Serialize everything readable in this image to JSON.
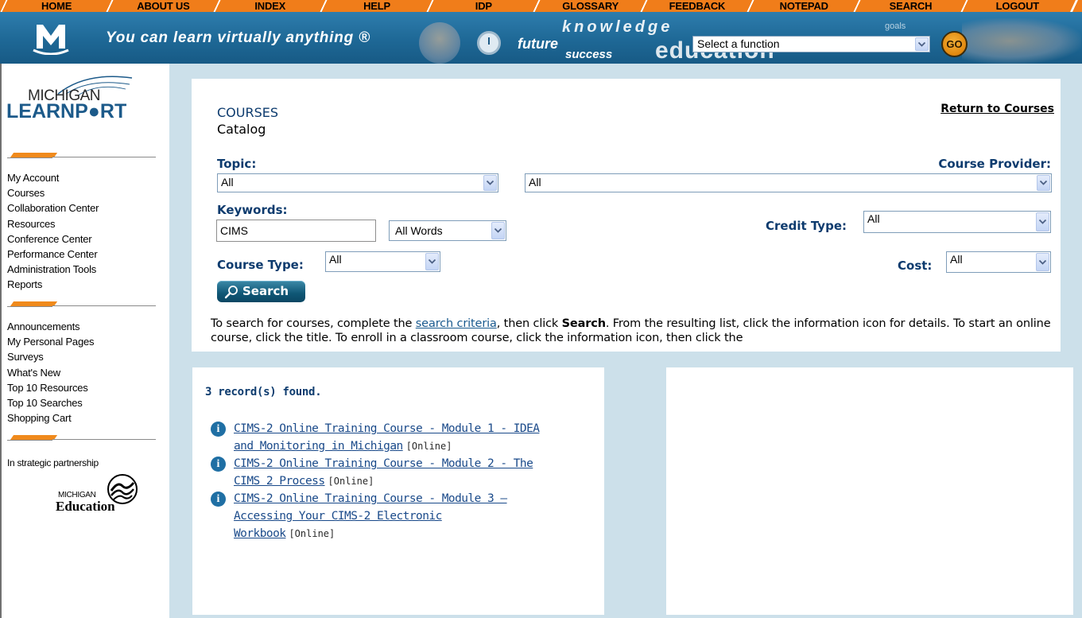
{
  "nav": {
    "items": [
      "HOME",
      "ABOUT US",
      "INDEX",
      "HELP",
      "IDP",
      "GLOSSARY",
      "FEEDBACK",
      "NOTEPAD",
      "SEARCH",
      "LOGOUT"
    ]
  },
  "banner": {
    "slogan": "You can learn virtually anything ®",
    "word_knowledge": "knowledge",
    "word_future": "future",
    "word_success": "success",
    "word_goals": "goals",
    "word_education": "education",
    "function_select": "Select a function",
    "go_label": "GO"
  },
  "sidebar": {
    "logo_top": "MICHIGAN",
    "logo_bottom": "LEARNP●RT",
    "group1": [
      "My Account",
      "Courses",
      "Collaboration Center",
      "Resources",
      "Conference Center",
      "Performance Center",
      "Administration Tools",
      "Reports"
    ],
    "group2": [
      "Announcements",
      "My Personal Pages",
      "Surveys",
      "What's New",
      "Top 10 Resources",
      "Top 10 Searches",
      "Shopping Cart"
    ],
    "partnership": "In strategic partnership",
    "partner_logo_top": "MICHIGAN",
    "partner_logo_bottom": "Education"
  },
  "search": {
    "section_title": "COURSES",
    "section_subtitle": "Catalog",
    "return_link": "Return to Courses",
    "topic_label": "Topic:",
    "topic_value": "All",
    "provider_label": "Course Provider:",
    "provider_value": "All",
    "keywords_label": "Keywords:",
    "keywords_value": "CIMS",
    "match_value": "All Words",
    "credit_label": "Credit Type:",
    "credit_value": "All",
    "coursetype_label": "Course Type:",
    "coursetype_value": "All",
    "cost_label": "Cost:",
    "cost_value": "All",
    "search_button": "Search",
    "instr_1": "To search for courses, complete the ",
    "instr_link": "search criteria",
    "instr_2": ", then click ",
    "instr_bold": "Search",
    "instr_3": ". From the resulting list, click the information icon for details. To start an online course, click the title. To enroll in a classroom course, click the information icon, then click the"
  },
  "results": {
    "found_text": "3 record(s) found.",
    "items": [
      {
        "title_line1": "CIMS-2 Online Training Course - Module 1 - IDEA",
        "title_line2": "and Monitoring in Michigan",
        "tag": "[Online]"
      },
      {
        "title_line1": "CIMS-2 Online Training Course - Module 2 - The",
        "title_line2": "CIMS 2 Process",
        "tag": "[Online]"
      },
      {
        "title_line1": "CIMS-2 Online Training Course - Module 3 –",
        "title_line2": "Accessing Your CIMS-2 Electronic",
        "title_line3": "Workbook",
        "tag": "[Online]"
      }
    ]
  },
  "colors": {
    "nav_orange": "#f07d1a",
    "banner_blue": "#1e6896",
    "main_bg": "#cce0ea",
    "label_blue": "#0d3b6e"
  }
}
